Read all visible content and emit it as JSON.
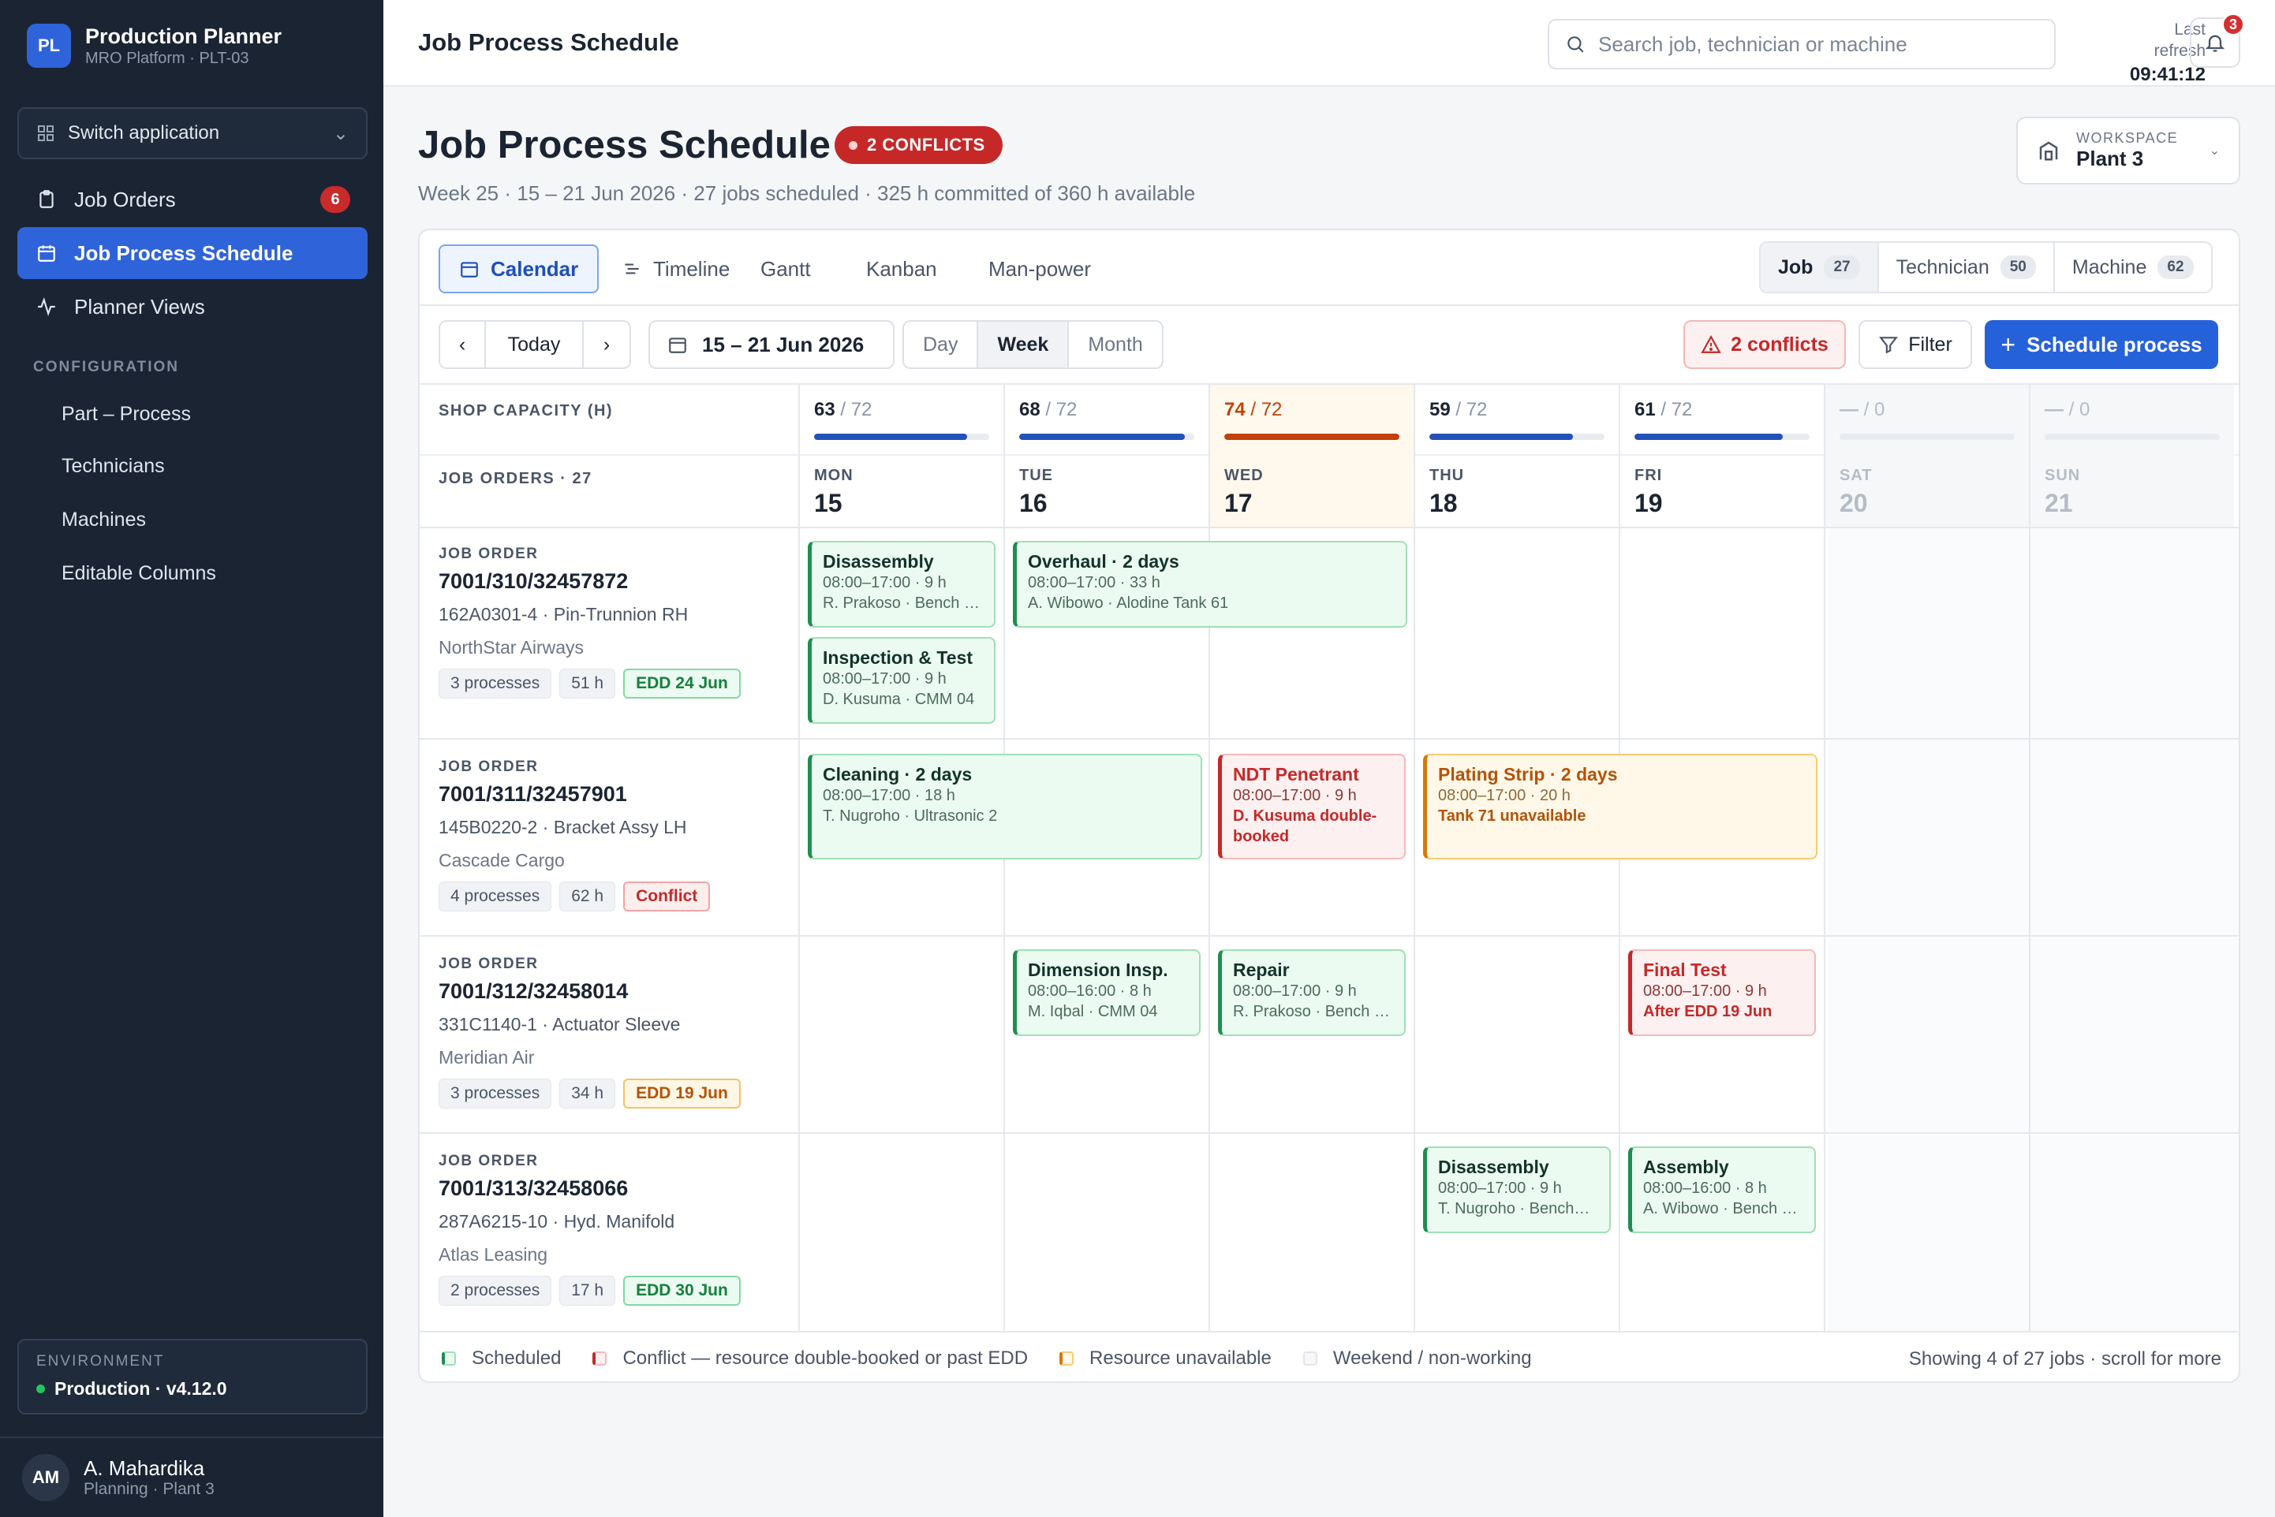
{
  "app": {
    "logo": "PL",
    "name": "Production Planner",
    "sub": "MRO Platform · PLT-03"
  },
  "sidebar": {
    "switch_label": "Switch application",
    "items": [
      {
        "label": "Job Orders",
        "icon": "clipboard-icon",
        "badge": "6"
      },
      {
        "label": "Job Process Schedule",
        "icon": "calendar-icon",
        "active": true
      },
      {
        "label": "Planner Views",
        "icon": "activity-icon"
      }
    ],
    "section": "CONFIGURATION",
    "config_items": [
      "Part – Process",
      "Technicians",
      "Machines",
      "Editable Columns"
    ],
    "env_label": "ENVIRONMENT",
    "env_value": "Production · v4.12.0",
    "user": {
      "initials": "AM",
      "name": "A. Mahardika",
      "role": "Planning · Plant 3"
    }
  },
  "header": {
    "title": "Job Process Schedule",
    "search_placeholder": "Search job, technician or machine",
    "refresh_label_1": "Last",
    "refresh_label_2": "refresh",
    "refresh_time": "09:41:12",
    "notif_count": "3"
  },
  "page": {
    "title": "Job Process Schedule",
    "conflict_pill": "2 CONFLICTS",
    "subtitle": "Week 25 · 15 – 21 Jun 2026 · 27 jobs scheduled · 325 h committed of 360 h available",
    "workspace_label": "WORKSPACE",
    "workspace_value": "Plant 3"
  },
  "views": [
    "Calendar",
    "Timeline",
    "Gantt",
    "Kanban",
    "Man-power"
  ],
  "group_by": [
    {
      "label": "Job",
      "count": "27",
      "on": true
    },
    {
      "label": "Technician",
      "count": "50"
    },
    {
      "label": "Machine",
      "count": "62"
    }
  ],
  "controls": {
    "prev": "‹",
    "today": "Today",
    "next": "›",
    "date_range": "15 – 21 Jun 2026",
    "ranges": [
      "Day",
      "Week",
      "Month"
    ],
    "conflicts_btn": "2 conflicts",
    "filter_btn": "Filter",
    "schedule_btn": "Schedule process"
  },
  "grid": {
    "capacity_label": "SHOP CAPACITY (H)",
    "job_orders_label": "JOB ORDERS · 27",
    "days": [
      {
        "name": "MON",
        "date": "15",
        "used": "63",
        "cap": "/ 72",
        "fill": 0.875
      },
      {
        "name": "TUE",
        "date": "16",
        "used": "68",
        "cap": "/ 72",
        "fill": 0.944
      },
      {
        "name": "WED",
        "date": "17",
        "used": "74",
        "cap": "/ 72",
        "fill": 1.0,
        "over": true
      },
      {
        "name": "THU",
        "date": "18",
        "used": "59",
        "cap": "/ 72",
        "fill": 0.82
      },
      {
        "name": "FRI",
        "date": "19",
        "used": "61",
        "cap": "/ 72",
        "fill": 0.847
      },
      {
        "name": "SAT",
        "date": "20",
        "used": "—",
        "cap": "/ 0",
        "fill": 0,
        "weekend": true
      },
      {
        "name": "SUN",
        "date": "21",
        "used": "—",
        "cap": "/ 0",
        "fill": 0,
        "weekend": true
      }
    ],
    "jobs": [
      {
        "label": "JOB ORDER",
        "no": "7001/310/32457872",
        "part": "162A0301-4 · Pin-Trunnion RH",
        "customer": "NorthStar Airways",
        "procs": "3 processes",
        "hours": "51 h",
        "edd": "EDD 24 Jun",
        "edd_kind": "green"
      },
      {
        "label": "JOB ORDER",
        "no": "7001/311/32457901",
        "part": "145B0220-2 · Bracket Assy LH",
        "customer": "Cascade Cargo",
        "procs": "4 processes",
        "hours": "62 h",
        "edd": "Conflict",
        "edd_kind": "red"
      },
      {
        "label": "JOB ORDER",
        "no": "7001/312/32458014",
        "part": "331C1140-1 · Actuator Sleeve",
        "customer": "Meridian Air",
        "procs": "3 processes",
        "hours": "34 h",
        "edd": "EDD 19 Jun",
        "edd_kind": "amber"
      },
      {
        "label": "JOB ORDER",
        "no": "7001/313/32458066",
        "part": "287A6215-10 · Hyd. Manifold",
        "customer": "Atlas Leasing",
        "procs": "2 processes",
        "hours": "17 h",
        "edd": "EDD 30 Jun",
        "edd_kind": "green"
      }
    ],
    "blocks": [
      {
        "title": "Disassembly",
        "time": "08:00–17:00 · 9 h",
        "sub": "R. Prakoso · Bench …"
      },
      {
        "title": "Inspection & Test",
        "time": "08:00–17:00 · 9 h",
        "sub": "D. Kusuma · CMM 04"
      },
      {
        "title": "Overhaul · 2 days",
        "time": "08:00–17:00 · 33 h",
        "sub": "A. Wibowo · Alodine Tank 61"
      },
      {
        "title": "Cleaning · 2 days",
        "time": "08:00–17:00 · 18 h",
        "sub": "T. Nugroho · Ultrasonic 2"
      },
      {
        "title": "NDT Penetrant",
        "time": "08:00–17:00 · 9 h",
        "sub": "D. Kusuma double-booked"
      },
      {
        "title": "Plating Strip · 2 days",
        "time": "08:00–17:00 · 20 h",
        "sub": "Tank 71 unavailable"
      },
      {
        "title": "Dimension Insp.",
        "time": "08:00–16:00 · 8 h",
        "sub": "M. Iqbal · CMM 04"
      },
      {
        "title": "Repair",
        "time": "08:00–17:00 · 9 h",
        "sub": "R. Prakoso · Bench …"
      },
      {
        "title": "Final Test",
        "time": "08:00–17:00 · 9 h",
        "sub": "After EDD 19 Jun"
      },
      {
        "title": "Disassembly",
        "time": "08:00–17:00 · 9 h",
        "sub": "T. Nugroho · Bench…"
      },
      {
        "title": "Assembly",
        "time": "08:00–16:00 · 8 h",
        "sub": "A. Wibowo · Bench …"
      }
    ]
  },
  "legend": {
    "items": [
      "Scheduled",
      "Conflict — resource double-booked or past EDD",
      "Resource unavailable",
      "Weekend / non-working"
    ],
    "showing": "Showing 4 of 27 jobs · scroll for more"
  },
  "colors": {
    "primary": "#2561d9",
    "sidebar": "#1a2433",
    "conflict": "#c62828",
    "scheduled": "#1e8e4f",
    "unavailable": "#d97706"
  }
}
